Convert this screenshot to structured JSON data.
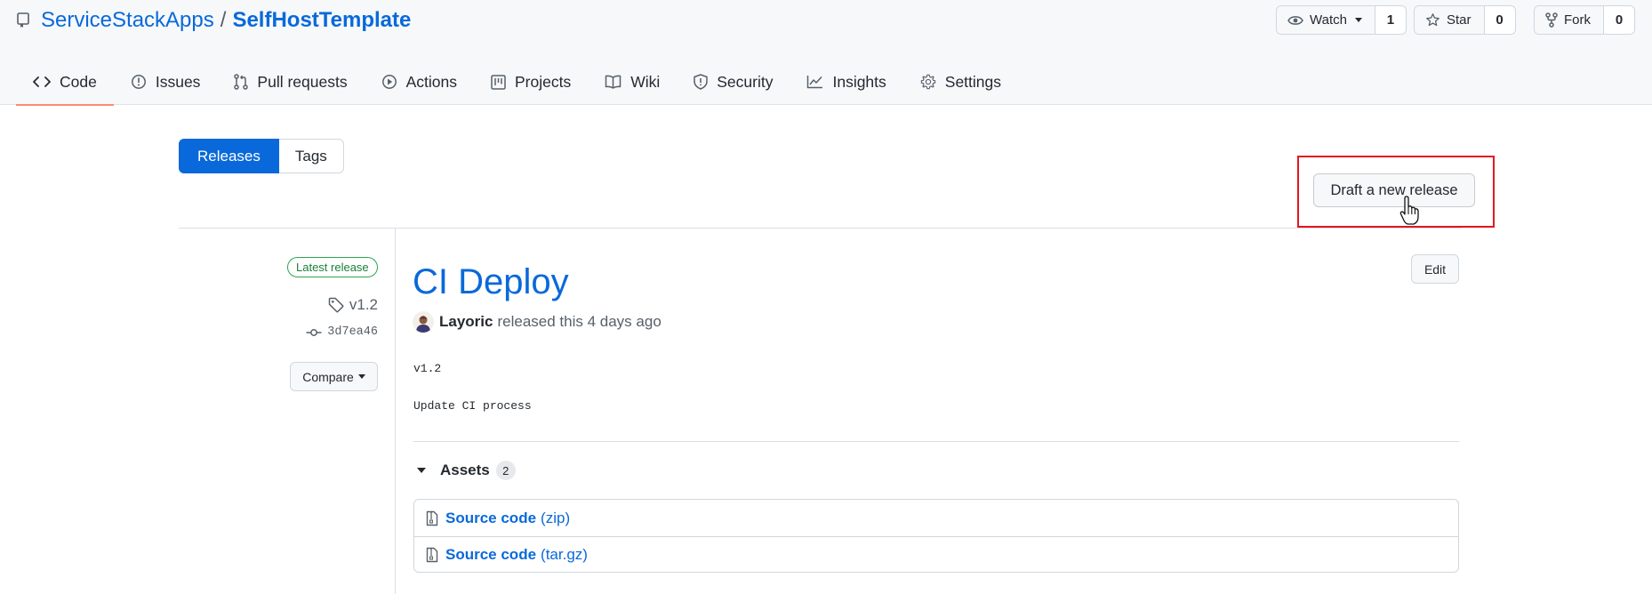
{
  "repo": {
    "owner": "ServiceStackApps",
    "separator": "/",
    "name": "SelfHostTemplate"
  },
  "header_actions": [
    {
      "label": "Watch",
      "count": "1",
      "icon": "eye-icon"
    },
    {
      "label": "Star",
      "count": "0",
      "icon": "star-icon"
    },
    {
      "label": "Fork",
      "count": "0",
      "icon": "fork-icon"
    }
  ],
  "tabs": [
    {
      "label": "Code",
      "icon": "code-icon",
      "selected": true
    },
    {
      "label": "Issues",
      "icon": "issue-icon"
    },
    {
      "label": "Pull requests",
      "icon": "pull-request-icon"
    },
    {
      "label": "Actions",
      "icon": "play-icon"
    },
    {
      "label": "Projects",
      "icon": "project-icon"
    },
    {
      "label": "Wiki",
      "icon": "book-icon"
    },
    {
      "label": "Security",
      "icon": "shield-icon"
    },
    {
      "label": "Insights",
      "icon": "graph-icon"
    },
    {
      "label": "Settings",
      "icon": "gear-icon"
    }
  ],
  "subnav": {
    "releases": "Releases",
    "tags": "Tags"
  },
  "draft_button": "Draft a new release",
  "release": {
    "badge": "Latest release",
    "tag": "v1.2",
    "commit": "3d7ea46",
    "compare": "Compare",
    "title": "CI Deploy",
    "edit": "Edit",
    "author": "Layoric",
    "released_text": "released this 4 days ago",
    "body_lines": [
      "v1.2",
      "Update CI process"
    ],
    "assets_label": "Assets",
    "assets_count": "2",
    "assets": [
      {
        "label": "Source code",
        "format": "(zip)"
      },
      {
        "label": "Source code",
        "format": "(tar.gz)"
      }
    ]
  },
  "colors": {
    "accent": "#0969da",
    "highlight": "#e3161f",
    "badge": "#1a7f37",
    "tab_underline": "#fd8c73"
  }
}
